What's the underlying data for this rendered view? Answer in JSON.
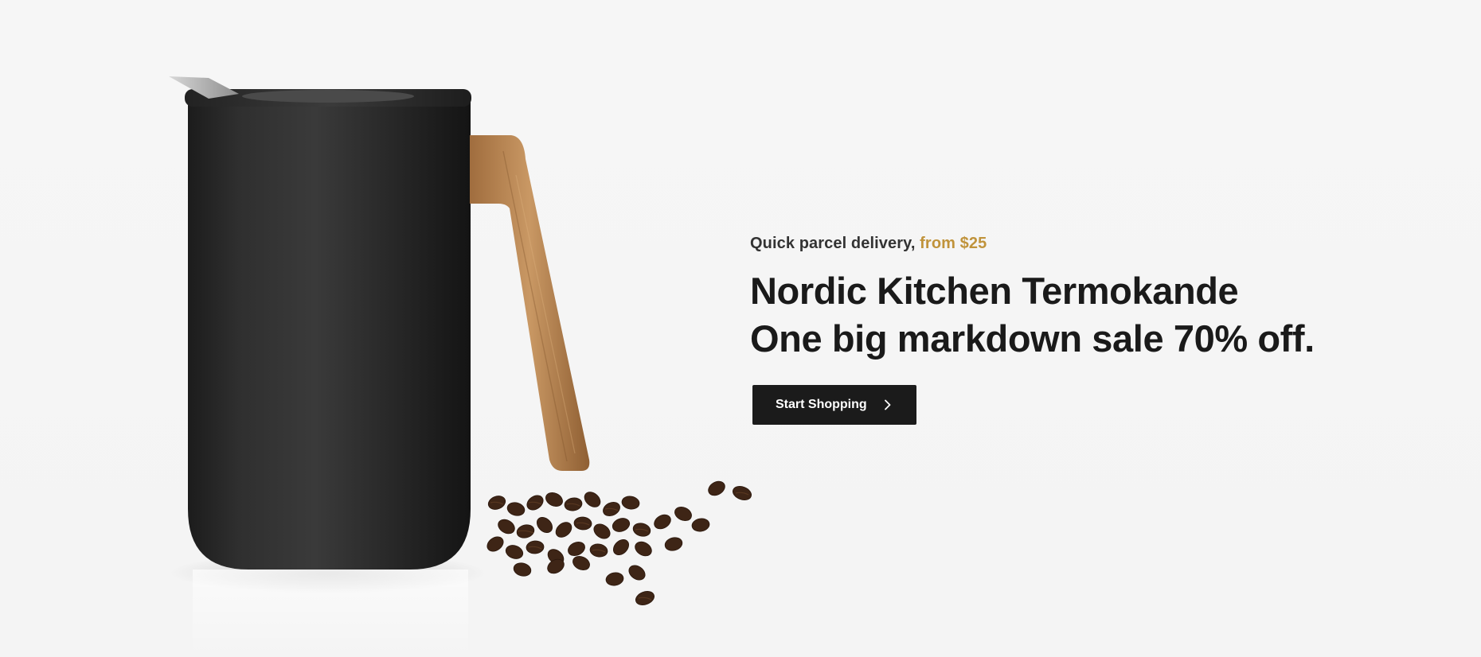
{
  "hero": {
    "eyebrow_text": "Quick parcel delivery,",
    "eyebrow_accent": "from $25",
    "headline_line1": "Nordic Kitchen Termokande",
    "headline_line2": "One big markdown sale 70% off.",
    "cta_label": "Start Shopping",
    "cta_icon": "chevron-right-icon",
    "product_image": "thermos-jug-with-wooden-handle-and-coffee-beans"
  },
  "colors": {
    "background": "#f5f5f5",
    "accent": "#c0933b",
    "text": "#1b1b1b",
    "button_bg": "#1b1b1b",
    "button_text": "#ffffff"
  }
}
